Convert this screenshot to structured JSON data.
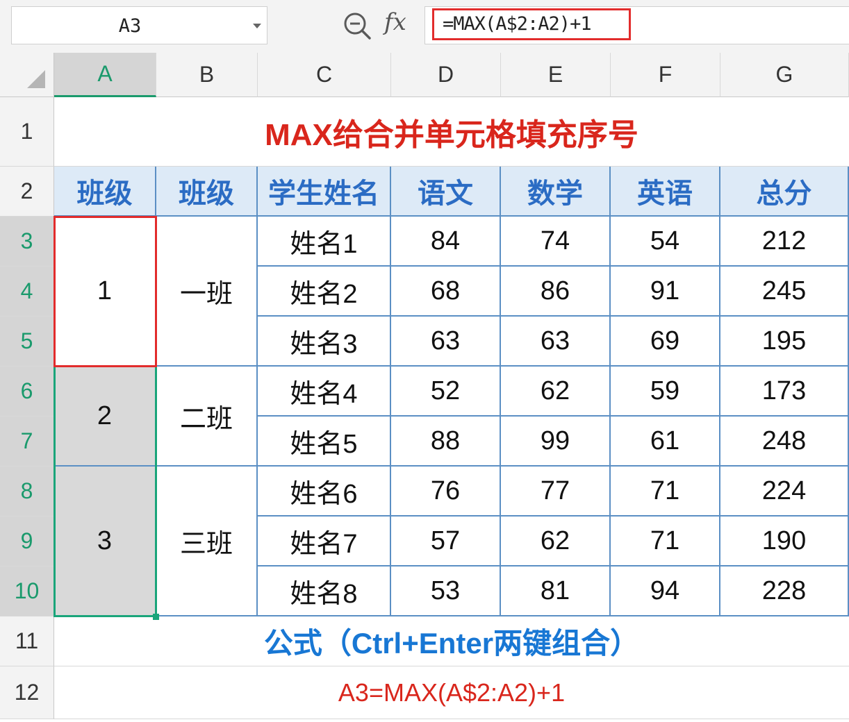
{
  "name_box": {
    "value": "A3"
  },
  "formula_bar": {
    "formula": "=MAX(A$2:A2)+1",
    "fx_label": "fx"
  },
  "columns": [
    "A",
    "B",
    "C",
    "D",
    "E",
    "F",
    "G"
  ],
  "rows": [
    "1",
    "2",
    "3",
    "4",
    "5",
    "6",
    "7",
    "8",
    "9",
    "10",
    "11",
    "12"
  ],
  "sheet": {
    "title": "MAX给合并单元格填充序号",
    "headers": [
      "班级",
      "班级",
      "学生姓名",
      "语文",
      "数学",
      "英语",
      "总分"
    ],
    "groups": [
      {
        "seq": "1",
        "class": "一班"
      },
      {
        "seq": "2",
        "class": "二班"
      },
      {
        "seq": "3",
        "class": "三班"
      }
    ],
    "students": [
      {
        "name": "姓名1",
        "chinese": "84",
        "math": "74",
        "english": "54",
        "total": "212"
      },
      {
        "name": "姓名2",
        "chinese": "68",
        "math": "86",
        "english": "91",
        "total": "245"
      },
      {
        "name": "姓名3",
        "chinese": "63",
        "math": "63",
        "english": "69",
        "total": "195"
      },
      {
        "name": "姓名4",
        "chinese": "52",
        "math": "62",
        "english": "59",
        "total": "173"
      },
      {
        "name": "姓名5",
        "chinese": "88",
        "math": "99",
        "english": "61",
        "total": "248"
      },
      {
        "name": "姓名6",
        "chinese": "76",
        "math": "77",
        "english": "71",
        "total": "224"
      },
      {
        "name": "姓名7",
        "chinese": "57",
        "math": "62",
        "english": "71",
        "total": "190"
      },
      {
        "name": "姓名8",
        "chinese": "53",
        "math": "81",
        "english": "94",
        "total": "228"
      }
    ],
    "note": "公式（Ctrl+Enter两键组合）",
    "formula_note": "A3=MAX(A$2:A2)+1"
  },
  "colors": {
    "accent_green": "#1aa57a",
    "highlight_red": "#e22c2c",
    "header_blue": "#2b6cc4",
    "border_blue": "#5b8fc4"
  },
  "icons": {
    "zoom": "zoom-magnifier-icon",
    "formula": "fx-icon"
  }
}
